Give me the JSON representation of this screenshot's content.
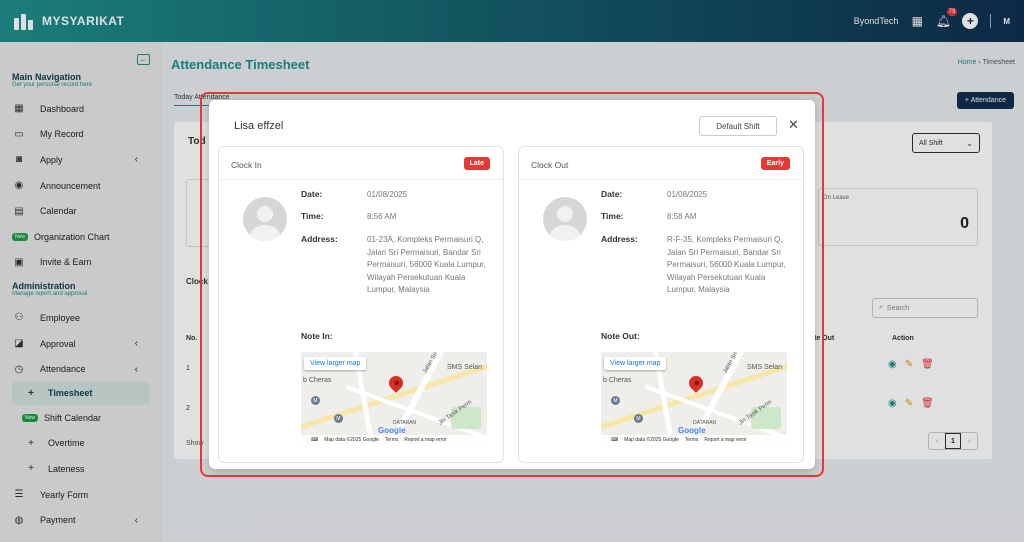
{
  "app": {
    "name": "MYSYARIKAT"
  },
  "topbar": {
    "company": "ByondTech",
    "notification_count": "79",
    "user_initials": "M"
  },
  "sidebar": {
    "main_title": "Main Navigation",
    "main_sub": "Get your personal record here",
    "main_items": [
      {
        "label": "Dashboard",
        "icon": "grid-icon"
      },
      {
        "label": "My Record",
        "icon": "folder-icon"
      },
      {
        "label": "Apply",
        "icon": "clipboard-icon"
      },
      {
        "label": "Announcement",
        "icon": "megaphone-icon"
      },
      {
        "label": "Calendar",
        "icon": "calendar-icon"
      },
      {
        "label": "Organization Chart",
        "icon": "new-tag"
      },
      {
        "label": "Invite & Earn",
        "icon": "gift-icon"
      }
    ],
    "admin_title": "Administration",
    "admin_sub": "Manage report and approval",
    "admin_items": [
      {
        "label": "Employee"
      },
      {
        "label": "Approval"
      },
      {
        "label": "Attendance"
      },
      {
        "label": "Timesheet"
      },
      {
        "label": "Shift Calendar"
      },
      {
        "label": "Overtime"
      },
      {
        "label": "Lateness"
      },
      {
        "label": "Yearly Form"
      },
      {
        "label": "Payment"
      }
    ],
    "new_label": "New"
  },
  "page": {
    "title": "Attendance Timesheet",
    "breadcrumb_home": "Home",
    "breadcrumb_current": "Timesheet",
    "tab_today": "Today Attendance",
    "add_button": "+ Attendance",
    "today_label": "Tod",
    "shift_filter": "All Shift",
    "leave_label": "On Leave",
    "leave_count": "0",
    "clock_tab": "Clock",
    "search_placeholder": "Search",
    "col_no": "No.",
    "col_out": "te Out",
    "col_action": "Action",
    "row1": "1",
    "row2": "2",
    "show_label": "Show",
    "page_current": "1"
  },
  "modal": {
    "employee_name": "Lisa effzel",
    "shift": "Default Shift",
    "clock_in": {
      "title": "Clock In",
      "status": "Late",
      "date_label": "Date:",
      "date": "01/08/2025",
      "time_label": "Time:",
      "time": "8:56 AM",
      "address_label": "Address:",
      "address": "01-23A, Kompleks Permaisuri Q, Jalan Sri Permaisuri, Bandar Sri Permaisuri, 56000 Kuala Lumpur, Wilayah Persekutuan Kuala Lumpur, Malaysia",
      "note_label": "Note In:"
    },
    "clock_out": {
      "title": "Clock Out",
      "status": "Early",
      "date_label": "Date:",
      "date": "01/08/2025",
      "time_label": "Time:",
      "time": "8:58 AM",
      "address_label": "Address:",
      "address": "R-F-35, Kompleks Permaisuri Q, Jalan Sri Permaisuri, Bandar Sri Permaisuri, 56000 Kuala Lumpur, Wilayah Persekutuan Kuala Lumpur, Malaysia",
      "note_label": "Note Out:"
    },
    "map": {
      "view_larger": "View larger map",
      "label_sms": "SMS Selan",
      "label_cheras": "b Cheras",
      "label_jalan": "Jalan Sri",
      "label_jln": "Jln Tasik Perm",
      "label_dataran": "DATARAN",
      "google": "Google",
      "footer_data": "Map data ©2025 Google",
      "footer_terms": "Terms",
      "footer_report": "Report a map error"
    }
  },
  "colors": {
    "accent": "#1f8f8c",
    "navy": "#0f2f4f",
    "danger": "#e53935"
  }
}
